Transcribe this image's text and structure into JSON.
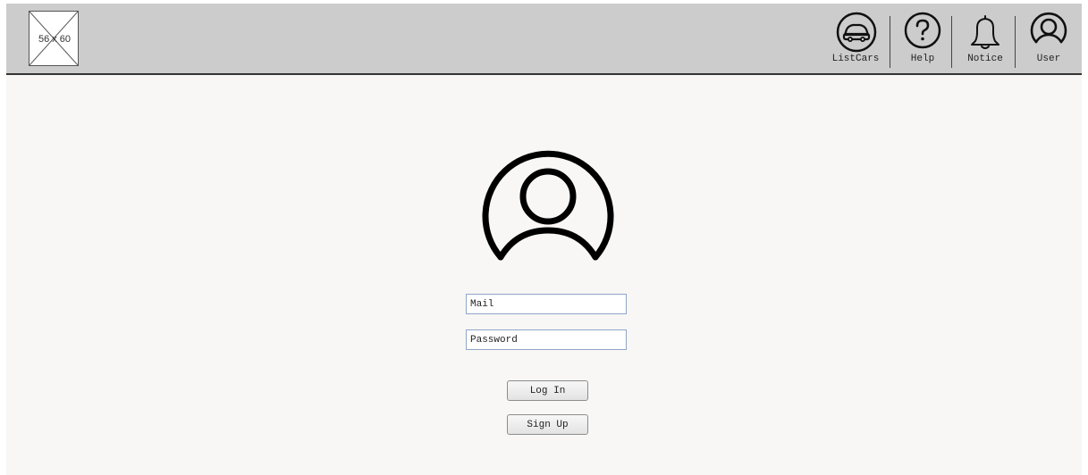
{
  "header": {
    "logo_placeholder": "56 x 60",
    "nav": [
      {
        "label": "ListCars",
        "icon": "car-icon"
      },
      {
        "label": "Help",
        "icon": "help-icon"
      },
      {
        "label": "Notice",
        "icon": "bell-icon"
      },
      {
        "label": "User",
        "icon": "user-icon"
      }
    ]
  },
  "login": {
    "avatar_icon": "user-avatar-icon",
    "mail_placeholder": "Mail",
    "password_placeholder": "Password",
    "login_label": "Log In",
    "signup_label": "Sign Up"
  },
  "colors": {
    "header_bg": "#cccccc",
    "page_bg": "#f8f7f5",
    "field_border": "#8fa6c7"
  }
}
